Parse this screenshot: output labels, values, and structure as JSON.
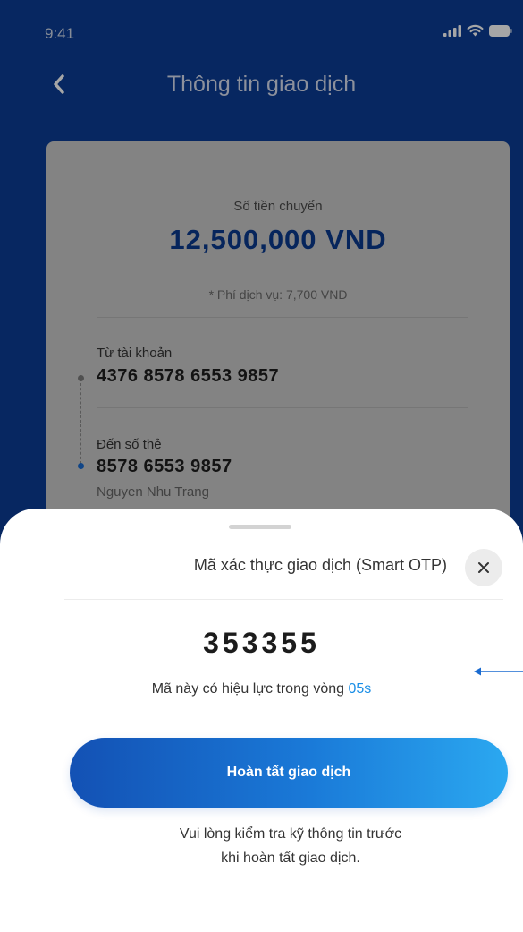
{
  "status_bar": {
    "time": "9:41"
  },
  "header": {
    "title": "Thông tin giao dịch",
    "back_icon": "chevron-left-icon"
  },
  "transaction": {
    "amount_label": "Số tiền chuyển",
    "amount": "12,500,000 VND",
    "fee": "* Phí dịch vụ: 7,700 VND",
    "from_label": "Từ tài khoản",
    "from_account": "4376 8578 6553 9857",
    "to_label": "Đến số thẻ",
    "to_card": "8578 6553 9857",
    "to_name": "Nguyen Nhu Trang"
  },
  "otp_sheet": {
    "title": "Mã xác thực giao dịch (Smart OTP)",
    "close_icon": "close-icon",
    "code": "353355",
    "validity_text": "Mã này có hiệu lực trong vòng ",
    "validity_timer": "05s",
    "complete_button": "Hoàn tất giao dịch",
    "hint_line1": "Vui lòng kiểm tra kỹ thông tin trước",
    "hint_line2": "khi hoàn tất giao dịch."
  },
  "colors": {
    "primary_blue": "#0b3d95",
    "amount_blue": "#0a3a8e",
    "timer_blue": "#1a8ee6",
    "button_gradient_start": "#1351b4",
    "button_gradient_end": "#2ba8f0"
  }
}
